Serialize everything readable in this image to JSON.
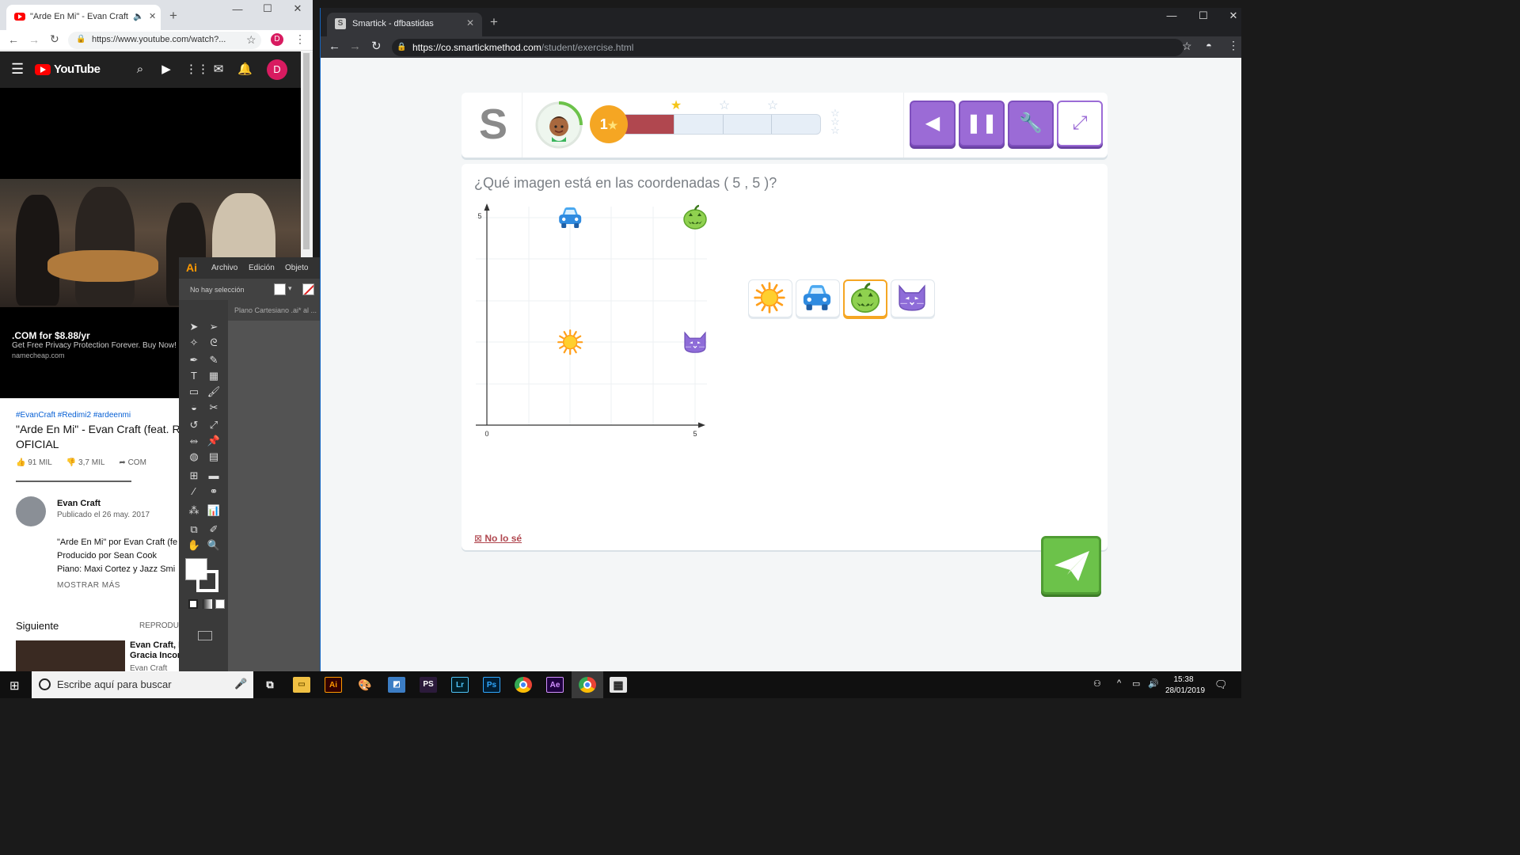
{
  "left_browser": {
    "tab_title": "\"Arde En Mi\" - Evan Craft (fe",
    "url": "https://www.youtube.com/watch?...",
    "profile_initial": "D"
  },
  "youtube": {
    "logo_text": "YouTube",
    "profile_initial": "D",
    "ad_line1": ".COM for $8.88/yr",
    "ad_line2": "Get Free Privacy Protection Forever. Buy Now!",
    "ad_line3": "namecheap.com",
    "hashtags": "#EvanCraft #Redimi2 #ardeenmi",
    "video_title": "\"Arde En Mi\" - Evan Craft (feat. R OFICIAL",
    "likes": "91 MIL",
    "dislikes": "3,7 MIL",
    "share": "COM",
    "channel": "Evan Craft",
    "published": "Publicado el 26 may. 2017",
    "desc_lines": [
      "\"Arde En Mi\" por Evan Craft (fe",
      "Producido por Sean Cook",
      "Piano: Maxi Cortez y Jazz Smi"
    ],
    "show_more": "MOSTRAR MÁS",
    "up_next": "Siguiente",
    "autoplay": "REPRODU",
    "next_title_1": "Evan Craft, E",
    "next_title_2": "Gracia Incor",
    "next_channel": "Evan Craft"
  },
  "illustrator": {
    "logo": "Ai",
    "menu": [
      "Archivo",
      "Edición",
      "Objeto"
    ],
    "selection": "No hay selección",
    "doc_tab": "Plano Cartesiano .ai* al ..."
  },
  "right_browser": {
    "tab_title": "Smartick - dfbastidas",
    "url_host": "https://co.smartickmethod.com",
    "url_path": "/student/exercise.html"
  },
  "exercise": {
    "level": "1",
    "progress": 0.25,
    "question": "¿Qué imagen está en las coordenadas ( 5 , 5 )?",
    "axis_x_zero": "0",
    "axis_x_max": "5",
    "axis_y_max": "5",
    "plot_items": [
      {
        "name": "car",
        "x": 2,
        "y": 5
      },
      {
        "name": "pumpkin",
        "x": 5,
        "y": 5
      },
      {
        "name": "sun",
        "x": 2,
        "y": 2
      },
      {
        "name": "cat",
        "x": 5,
        "y": 2
      }
    ],
    "choices": [
      "sun",
      "car",
      "pumpkin",
      "cat"
    ],
    "selected": "pumpkin",
    "dont_know": "No lo sé"
  },
  "taskbar": {
    "search_placeholder": "Escribe aquí para buscar",
    "time": "15:38",
    "date": "28/01/2019"
  }
}
